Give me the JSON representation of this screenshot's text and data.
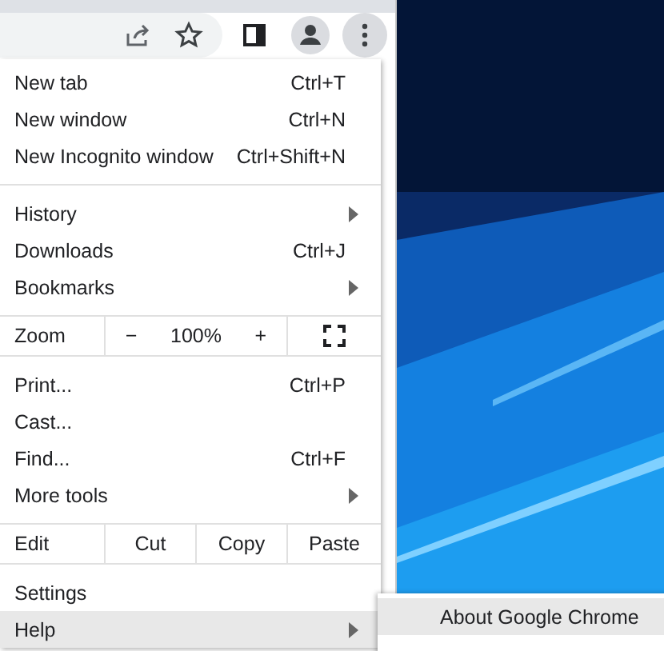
{
  "menu": {
    "items": [
      {
        "kind": "item",
        "label": "New tab",
        "shortcut": "Ctrl+T",
        "submenu": false,
        "selected": false
      },
      {
        "kind": "item",
        "label": "New window",
        "shortcut": "Ctrl+N",
        "submenu": false,
        "selected": false
      },
      {
        "kind": "item",
        "label": "New Incognito window",
        "shortcut": "Ctrl+Shift+N",
        "submenu": false,
        "selected": false
      },
      {
        "kind": "separator"
      },
      {
        "kind": "item",
        "label": "History",
        "submenu": true,
        "selected": false
      },
      {
        "kind": "item",
        "label": "Downloads",
        "shortcut": "Ctrl+J",
        "submenu": false,
        "selected": false
      },
      {
        "kind": "item",
        "label": "Bookmarks",
        "submenu": true,
        "selected": false
      },
      {
        "kind": "separator"
      },
      {
        "kind": "zoom",
        "label": "Zoom",
        "minus": "−",
        "value": "100%",
        "plus": "+"
      },
      {
        "kind": "separator"
      },
      {
        "kind": "item",
        "label": "Print...",
        "shortcut": "Ctrl+P",
        "submenu": false,
        "selected": false
      },
      {
        "kind": "item",
        "label": "Cast...",
        "submenu": false,
        "selected": false
      },
      {
        "kind": "item",
        "label": "Find...",
        "shortcut": "Ctrl+F",
        "submenu": false,
        "selected": false
      },
      {
        "kind": "item",
        "label": "More tools",
        "submenu": true,
        "selected": false
      },
      {
        "kind": "separator"
      },
      {
        "kind": "edit",
        "label": "Edit",
        "cut": "Cut",
        "copy": "Copy",
        "paste": "Paste"
      },
      {
        "kind": "separator"
      },
      {
        "kind": "item",
        "label": "Settings",
        "submenu": false,
        "selected": false
      },
      {
        "kind": "item",
        "label": "Help",
        "submenu": true,
        "selected": true
      }
    ]
  },
  "submenu": {
    "items": [
      {
        "label": "About Google Chrome",
        "selected": true
      }
    ]
  }
}
